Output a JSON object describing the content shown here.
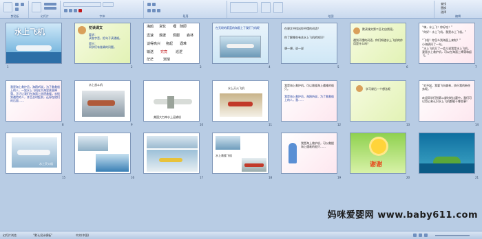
{
  "ribbon": {
    "groups": [
      "剪贴板",
      "幻灯片",
      "字体",
      "段落",
      "绘图"
    ],
    "find_label": "查找",
    "replace_label": "替换",
    "select_label": "选择",
    "edit_group": "编辑"
  },
  "slides": [
    {
      "num": "1",
      "title": "水上飞机"
    },
    {
      "num": "2",
      "heading": "初读课文",
      "lines": [
        "要求：",
        "读准字音，把句子读通顺。",
        "提示：",
        "同学们有准确的问题。"
      ]
    },
    {
      "num": "3",
      "words": [
        "海鸥",
        "货轮",
        "哩",
        "随即",
        "迅速",
        "救援",
        "佩服",
        "森林",
        "谈得高兴",
        "拖起",
        "遇难",
        "输送",
        "究竟",
        "巡逻",
        "茫茫",
        "渐渐"
      ]
    },
    {
      "num": "4",
      "caption": "在无垠的蔚蓝的海面上了我们飞机呢"
    },
    {
      "num": "5",
      "lines": [
        "在课文中找出你不懂的词语？",
        "你了解哪些有关水上飞机的知识？",
        "想一想，说一说"
      ]
    },
    {
      "num": "6",
      "lines": [
        "默读课文第二至七自然段，",
        "遇到不懂的词语，你们知道水上飞机的作用是什么吗？"
      ]
    },
    {
      "num": "7",
      "lines": [
        "“嗨，水上飞！你好哇！”",
        "“你好！水上飞机，我是水上飞机。”",
        "“飞机？你怎么到海面上来啦？”",
        "小海鸥问了一句。",
        "“水上飞机又了一会儿说我是水上飞机，我是水上救护机，可以在海面上降落和起飞。”"
      ]
    },
    {
      "num": "8",
      "lines": [
        "我是海上救护员，海鸥听说，为了救救船上的人，一架水上飞机在大海里紧急降落，正巧让我们在海面上巡逻救援，去找到遇险的人，并且及时赶到，还停在他们的后面……"
      ]
    },
    {
      "num": "9",
      "caption": "水上战斗机"
    },
    {
      "num": "10",
      "caption": "美国大力神水上运输机"
    },
    {
      "num": "11",
      "caption": "水上灭火飞机"
    },
    {
      "num": "12",
      "lines": [
        "我是海上救护机，可以救援海上遇难的船只。",
        "我是海上救护员，海鸥听说，为了救救船上的人，我……"
      ]
    },
    {
      "num": "13",
      "lines": [
        "学习课后一个想法呢"
      ]
    },
    {
      "num": "14",
      "lines": [
        "“对不起，我要飞向森林，执行我的新任务呢。”",
        "欢迎同学们到第二课时的比赛中，我们可以用心来认识水上飞机都能干哪些事！"
      ]
    },
    {
      "num": "15",
      "caption": "水上灭火机"
    },
    {
      "num": "16",
      "caption": ""
    },
    {
      "num": "17",
      "caption": ""
    },
    {
      "num": "18",
      "caption": "水上救援飞机"
    },
    {
      "num": "19",
      "lines": [
        "我是海上救护机，可以救援海上遇难的船只……"
      ]
    },
    {
      "num": "20",
      "title": "谢谢"
    },
    {
      "num": "21",
      "caption": ""
    }
  ],
  "status": {
    "view": "幻灯片浏览",
    "theme": "“默认设计模板”",
    "lang": "中文(中国)"
  },
  "watermark": "妈咪爱婴网 www.baby611.com"
}
